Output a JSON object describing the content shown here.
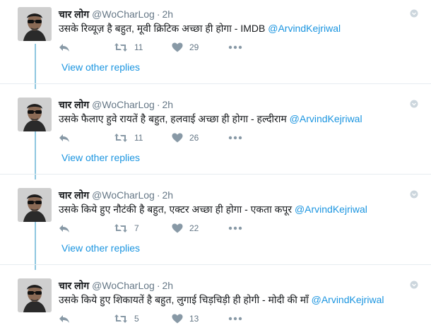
{
  "colors": {
    "link": "#1b95e0",
    "thread_line": "#8ec7e0",
    "secondary_text": "#657786",
    "divider": "#e6ecf0"
  },
  "tweets": [
    {
      "name": "चार लोग",
      "handle": "@WoCharLog",
      "separator": "·",
      "time": "2h",
      "text": "उसके रिव्यूज़ है बहुत, मूवी क्रिटिक अच्छा ही होगा - IMDB ",
      "mention": "@ArvindKejriwal",
      "retweets": "11",
      "likes": "29"
    },
    {
      "name": "चार लोग",
      "handle": "@WoCharLog",
      "separator": "·",
      "time": "2h",
      "text": "उसके फैलाए हुवे रायतें है बहुत, हलवाई अच्छा ही होगा - हल्दीराम ",
      "mention": "@ArvindKejriwal",
      "retweets": "11",
      "likes": "26"
    },
    {
      "name": "चार लोग",
      "handle": "@WoCharLog",
      "separator": "·",
      "time": "2h",
      "text": "उसके किये हुए नौटंकी है बहुत, एक्टर अच्छा ही होगा - एकता कपूर ",
      "mention": "@ArvindKejriwal",
      "retweets": "7",
      "likes": "22"
    },
    {
      "name": "चार लोग",
      "handle": "@WoCharLog",
      "separator": "·",
      "time": "2h",
      "text": "उसके किये हुए शिकायतें है बहुत, लुगाई चिड़चिड़ी ही होगी - मोदी की माँ ",
      "mention": "@ArvindKejriwal",
      "retweets": "5",
      "likes": "13"
    }
  ],
  "view_replies_label": "View other replies",
  "icons": {
    "reply": "reply-icon",
    "retweet": "retweet-icon",
    "like": "heart-icon",
    "more": "more-dots-icon",
    "caret": "caret-down-icon"
  }
}
